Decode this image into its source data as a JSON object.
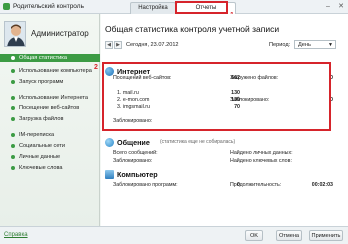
{
  "window": {
    "title": "Родительский контроль",
    "close_glyph": "✕"
  },
  "tabs": [
    {
      "label": "Настройка"
    },
    {
      "label": "Отчеты"
    }
  ],
  "sidebar": {
    "user": "Администратор",
    "items": [
      {
        "label": "Общая статистика"
      },
      {
        "label": "Использование компьютера"
      },
      {
        "label": "Запуск программ"
      },
      {
        "label": "Использование Интернета"
      },
      {
        "label": "Посещение веб-сайтов"
      },
      {
        "label": "Загрузка файлов"
      },
      {
        "label": "IM-переписка"
      },
      {
        "label": "Социальные сети"
      },
      {
        "label": "Личные данные"
      },
      {
        "label": "Ключевые слова"
      }
    ]
  },
  "main": {
    "title": "Общая статистика контроля учетной записи",
    "date": "Сегодня, 23.07.2012",
    "period_label": "Период:",
    "period_value": "День"
  },
  "internet": {
    "title": "Интернет",
    "visited_label": "Посещений веб-сайтов:",
    "visited_value": "662",
    "downloaded_label": "Загружено файлов:",
    "downloaded_value": "0",
    "sites": [
      {
        "name": "1. mail.ru",
        "value": "130"
      },
      {
        "name": "2. e-mon.com",
        "value": "130"
      },
      {
        "name": "3. imgsmail.ru",
        "value": "70"
      }
    ],
    "blocked_label": "Заблокировано:",
    "blocked_value": "0",
    "blocked2_label": "Заблокировано:",
    "blocked2_value": ""
  },
  "comm": {
    "title": "Общение",
    "note": "(статистика еще не собиралась)",
    "total_label": "Всего сообщений:",
    "personal_label": "Найдено личных данных:",
    "blocked_label": "Заблокировано:",
    "keywords_label": "Найдено ключевых слов:"
  },
  "computer": {
    "title": "Компьютер",
    "blocked_label": "Заблокировано программ:",
    "blocked_value": "0",
    "duration_label": "Продолжительность:",
    "duration_value": "00:02:03"
  },
  "annotations": {
    "marker1": "1",
    "marker2": "2"
  },
  "footer": {
    "help": "Справка",
    "ok": "OK",
    "cancel": "Отмена",
    "apply": "Применить"
  },
  "colors": {
    "accent": "#3c9b44",
    "highlight": "#d6242b"
  }
}
